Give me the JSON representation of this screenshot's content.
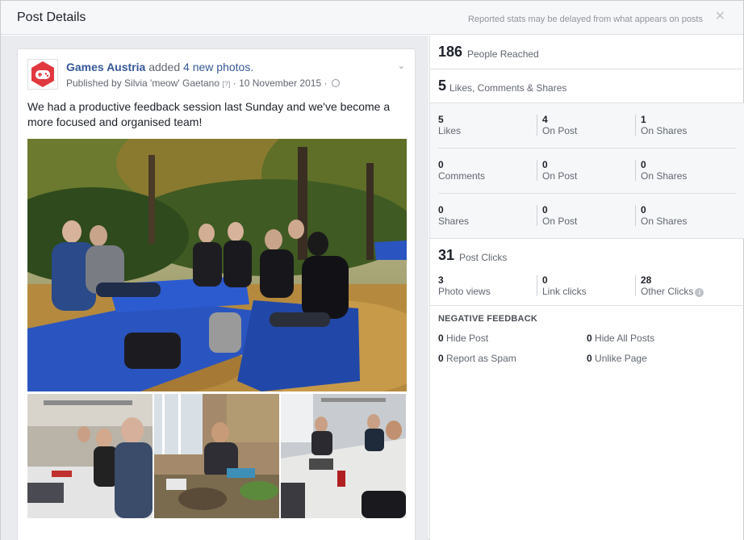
{
  "dialog": {
    "title": "Post Details",
    "note": "Reported stats may be delayed from what appears on posts",
    "close_glyph": "✕"
  },
  "post": {
    "page_name": "Games Austria",
    "action": "added",
    "photos_link": "4 new photos.",
    "published_by": "Published by Silvia 'meow' Gaetano",
    "help_marker": "[?]",
    "date": "· 10 November 2015 ·",
    "text": "We had a productive feedback session last Sunday and we've become a more focused and organised team!",
    "menu_glyph": "⌄",
    "avatar_color": "#e0383e",
    "photo_count": 4
  },
  "stats": {
    "reached": {
      "value": "186",
      "label": "People Reached"
    },
    "engagement": {
      "value": "5",
      "label": "Likes, Comments & Shares"
    },
    "likes": [
      {
        "value": "5",
        "label": "Likes"
      },
      {
        "value": "4",
        "label": "On Post"
      },
      {
        "value": "1",
        "label": "On Shares"
      }
    ],
    "comments": [
      {
        "value": "0",
        "label": "Comments"
      },
      {
        "value": "0",
        "label": "On Post"
      },
      {
        "value": "0",
        "label": "On Shares"
      }
    ],
    "shares": [
      {
        "value": "0",
        "label": "Shares"
      },
      {
        "value": "0",
        "label": "On Post"
      },
      {
        "value": "0",
        "label": "On Shares"
      }
    ],
    "post_clicks": {
      "value": "31",
      "label": "Post Clicks"
    },
    "clicks": [
      {
        "value": "3",
        "label": "Photo views"
      },
      {
        "value": "0",
        "label": "Link clicks"
      },
      {
        "value": "28",
        "label": "Other Clicks"
      }
    ]
  },
  "negative_feedback": {
    "title": "NEGATIVE FEEDBACK",
    "items": [
      {
        "value": "0",
        "label": "Hide Post"
      },
      {
        "value": "0",
        "label": "Hide All Posts"
      },
      {
        "value": "0",
        "label": "Report as Spam"
      },
      {
        "value": "0",
        "label": "Unlike Page"
      }
    ]
  },
  "colors": {
    "link": "#365899",
    "muted": "#616770",
    "panel_bg": "#e9ebee"
  }
}
